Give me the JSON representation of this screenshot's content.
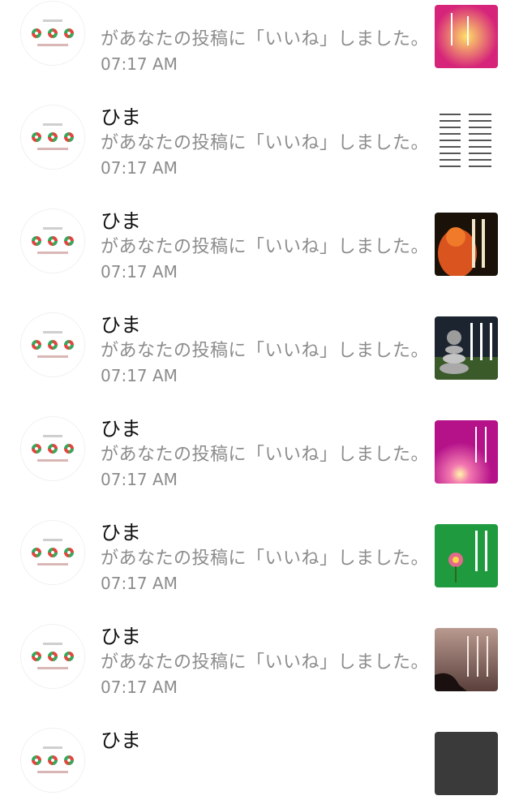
{
  "notifications": [
    {
      "name": "",
      "message": "があなたの投稿に「いいね」しました。",
      "time": "07:17 AM",
      "thumbnail_icon": "pink-yellow-post-thumbnail"
    },
    {
      "name": "ひま",
      "message": "があなたの投稿に「いいね」しました。",
      "time": "07:17 AM",
      "thumbnail_icon": "white-text-list-post-thumbnail"
    },
    {
      "name": "ひま",
      "message": "があなたの投稿に「いいね」しました。",
      "time": "07:17 AM",
      "thumbnail_icon": "orange-statue-post-thumbnail"
    },
    {
      "name": "ひま",
      "message": "があなたの投稿に「いいね」しました。",
      "time": "07:17 AM",
      "thumbnail_icon": "stone-stack-post-thumbnail"
    },
    {
      "name": "ひま",
      "message": "があなたの投稿に「いいね」しました。",
      "time": "07:17 AM",
      "thumbnail_icon": "magenta-light-post-thumbnail"
    },
    {
      "name": "ひま",
      "message": "があなたの投稿に「いいね」しました。",
      "time": "07:17 AM",
      "thumbnail_icon": "green-flower-post-thumbnail"
    },
    {
      "name": "ひま",
      "message": "があなたの投稿に「いいね」しました。",
      "time": "07:17 AM",
      "thumbnail_icon": "sunset-silhouette-post-thumbnail"
    },
    {
      "name": "ひま",
      "message": "",
      "time": "",
      "thumbnail_icon": "dark-post-thumbnail"
    }
  ],
  "avatar_icon": "three-swirl-logo-avatar",
  "colors": {
    "name": "#111111",
    "secondary_text": "#8c8c8c",
    "avatar_swirl_red": "#e0463c",
    "avatar_swirl_green": "#3aa55b"
  }
}
